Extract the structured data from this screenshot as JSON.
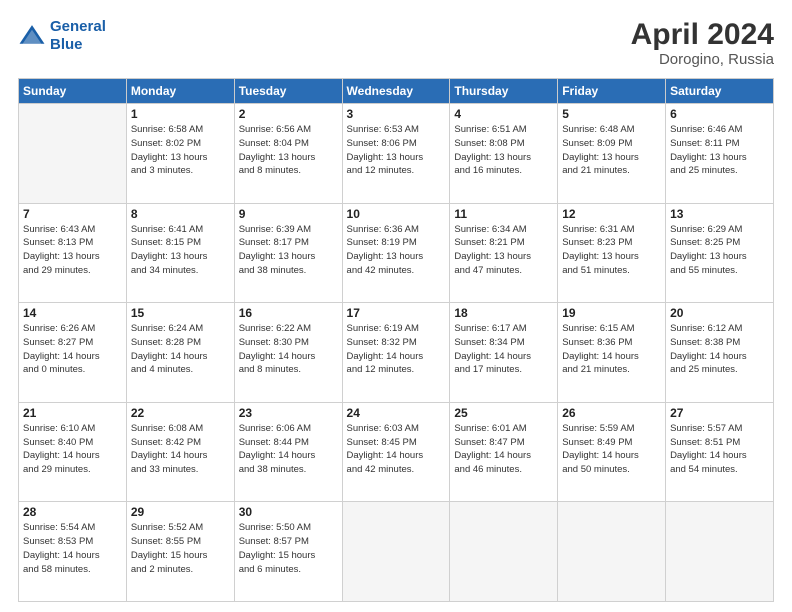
{
  "header": {
    "logo_line1": "General",
    "logo_line2": "Blue",
    "month_year": "April 2024",
    "location": "Dorogino, Russia"
  },
  "weekdays": [
    "Sunday",
    "Monday",
    "Tuesday",
    "Wednesday",
    "Thursday",
    "Friday",
    "Saturday"
  ],
  "weeks": [
    [
      {
        "day": "",
        "info": ""
      },
      {
        "day": "1",
        "info": "Sunrise: 6:58 AM\nSunset: 8:02 PM\nDaylight: 13 hours\nand 3 minutes."
      },
      {
        "day": "2",
        "info": "Sunrise: 6:56 AM\nSunset: 8:04 PM\nDaylight: 13 hours\nand 8 minutes."
      },
      {
        "day": "3",
        "info": "Sunrise: 6:53 AM\nSunset: 8:06 PM\nDaylight: 13 hours\nand 12 minutes."
      },
      {
        "day": "4",
        "info": "Sunrise: 6:51 AM\nSunset: 8:08 PM\nDaylight: 13 hours\nand 16 minutes."
      },
      {
        "day": "5",
        "info": "Sunrise: 6:48 AM\nSunset: 8:09 PM\nDaylight: 13 hours\nand 21 minutes."
      },
      {
        "day": "6",
        "info": "Sunrise: 6:46 AM\nSunset: 8:11 PM\nDaylight: 13 hours\nand 25 minutes."
      }
    ],
    [
      {
        "day": "7",
        "info": "Sunrise: 6:43 AM\nSunset: 8:13 PM\nDaylight: 13 hours\nand 29 minutes."
      },
      {
        "day": "8",
        "info": "Sunrise: 6:41 AM\nSunset: 8:15 PM\nDaylight: 13 hours\nand 34 minutes."
      },
      {
        "day": "9",
        "info": "Sunrise: 6:39 AM\nSunset: 8:17 PM\nDaylight: 13 hours\nand 38 minutes."
      },
      {
        "day": "10",
        "info": "Sunrise: 6:36 AM\nSunset: 8:19 PM\nDaylight: 13 hours\nand 42 minutes."
      },
      {
        "day": "11",
        "info": "Sunrise: 6:34 AM\nSunset: 8:21 PM\nDaylight: 13 hours\nand 47 minutes."
      },
      {
        "day": "12",
        "info": "Sunrise: 6:31 AM\nSunset: 8:23 PM\nDaylight: 13 hours\nand 51 minutes."
      },
      {
        "day": "13",
        "info": "Sunrise: 6:29 AM\nSunset: 8:25 PM\nDaylight: 13 hours\nand 55 minutes."
      }
    ],
    [
      {
        "day": "14",
        "info": "Sunrise: 6:26 AM\nSunset: 8:27 PM\nDaylight: 14 hours\nand 0 minutes."
      },
      {
        "day": "15",
        "info": "Sunrise: 6:24 AM\nSunset: 8:28 PM\nDaylight: 14 hours\nand 4 minutes."
      },
      {
        "day": "16",
        "info": "Sunrise: 6:22 AM\nSunset: 8:30 PM\nDaylight: 14 hours\nand 8 minutes."
      },
      {
        "day": "17",
        "info": "Sunrise: 6:19 AM\nSunset: 8:32 PM\nDaylight: 14 hours\nand 12 minutes."
      },
      {
        "day": "18",
        "info": "Sunrise: 6:17 AM\nSunset: 8:34 PM\nDaylight: 14 hours\nand 17 minutes."
      },
      {
        "day": "19",
        "info": "Sunrise: 6:15 AM\nSunset: 8:36 PM\nDaylight: 14 hours\nand 21 minutes."
      },
      {
        "day": "20",
        "info": "Sunrise: 6:12 AM\nSunset: 8:38 PM\nDaylight: 14 hours\nand 25 minutes."
      }
    ],
    [
      {
        "day": "21",
        "info": "Sunrise: 6:10 AM\nSunset: 8:40 PM\nDaylight: 14 hours\nand 29 minutes."
      },
      {
        "day": "22",
        "info": "Sunrise: 6:08 AM\nSunset: 8:42 PM\nDaylight: 14 hours\nand 33 minutes."
      },
      {
        "day": "23",
        "info": "Sunrise: 6:06 AM\nSunset: 8:44 PM\nDaylight: 14 hours\nand 38 minutes."
      },
      {
        "day": "24",
        "info": "Sunrise: 6:03 AM\nSunset: 8:45 PM\nDaylight: 14 hours\nand 42 minutes."
      },
      {
        "day": "25",
        "info": "Sunrise: 6:01 AM\nSunset: 8:47 PM\nDaylight: 14 hours\nand 46 minutes."
      },
      {
        "day": "26",
        "info": "Sunrise: 5:59 AM\nSunset: 8:49 PM\nDaylight: 14 hours\nand 50 minutes."
      },
      {
        "day": "27",
        "info": "Sunrise: 5:57 AM\nSunset: 8:51 PM\nDaylight: 14 hours\nand 54 minutes."
      }
    ],
    [
      {
        "day": "28",
        "info": "Sunrise: 5:54 AM\nSunset: 8:53 PM\nDaylight: 14 hours\nand 58 minutes."
      },
      {
        "day": "29",
        "info": "Sunrise: 5:52 AM\nSunset: 8:55 PM\nDaylight: 15 hours\nand 2 minutes."
      },
      {
        "day": "30",
        "info": "Sunrise: 5:50 AM\nSunset: 8:57 PM\nDaylight: 15 hours\nand 6 minutes."
      },
      {
        "day": "",
        "info": ""
      },
      {
        "day": "",
        "info": ""
      },
      {
        "day": "",
        "info": ""
      },
      {
        "day": "",
        "info": ""
      }
    ]
  ]
}
